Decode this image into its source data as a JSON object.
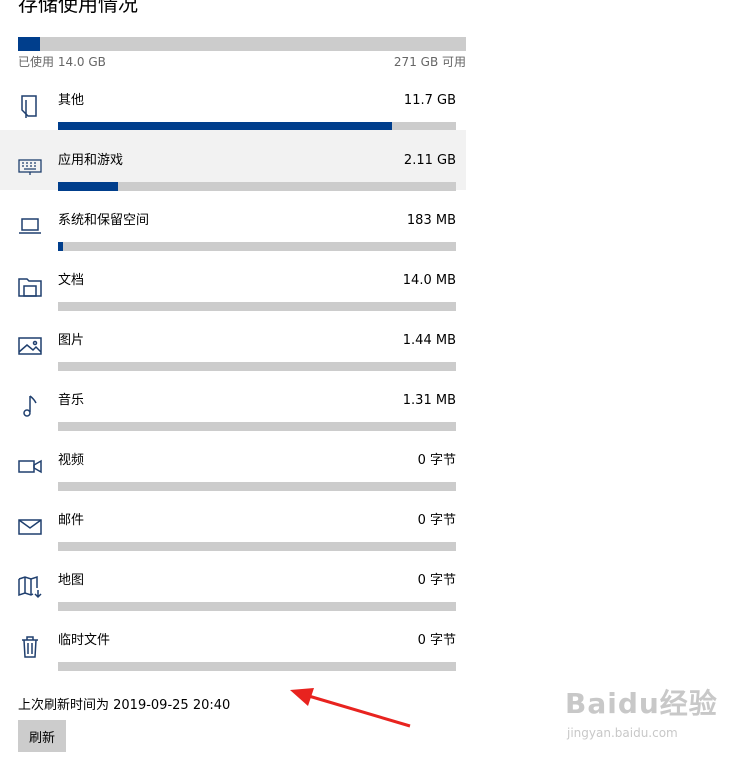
{
  "header": {
    "title": "存储使用情况"
  },
  "summary": {
    "used_label": "已使用 14.0 GB",
    "free_label": "271 GB 可用",
    "used_fraction": 0.049
  },
  "categories": [
    {
      "name": "其他",
      "size": "11.7 GB",
      "fraction": 0.838,
      "icon": "other-icon"
    },
    {
      "name": "应用和游戏",
      "size": "2.11 GB",
      "fraction": 0.151,
      "icon": "keyboard-icon"
    },
    {
      "name": "系统和保留空间",
      "size": "183 MB",
      "fraction": 0.012,
      "icon": "laptop-icon"
    },
    {
      "name": "文档",
      "size": "14.0 MB",
      "fraction": 0,
      "icon": "documents-folder-icon"
    },
    {
      "name": "图片",
      "size": "1.44 MB",
      "fraction": 0,
      "icon": "picture-icon"
    },
    {
      "name": "音乐",
      "size": "1.31 MB",
      "fraction": 0,
      "icon": "music-note-icon"
    },
    {
      "name": "视频",
      "size": "0 字节",
      "fraction": 0,
      "icon": "video-camera-icon"
    },
    {
      "name": "邮件",
      "size": "0 字节",
      "fraction": 0,
      "icon": "mail-icon"
    },
    {
      "name": "地图",
      "size": "0 字节",
      "fraction": 0,
      "icon": "map-icon"
    },
    {
      "name": "临时文件",
      "size": "0 字节",
      "fraction": 0,
      "icon": "trash-icon"
    }
  ],
  "footer": {
    "last_refresh": "上次刷新时间为 2019-09-25 20:40",
    "refresh_button": "刷新"
  },
  "watermark": {
    "brand": "Baidu经验",
    "url": "jingyan.baidu.com"
  },
  "colors": {
    "accent": "#003e8c",
    "track": "#cccccc",
    "highlight": "#f2f2f2",
    "arrow": "#e8231f"
  }
}
